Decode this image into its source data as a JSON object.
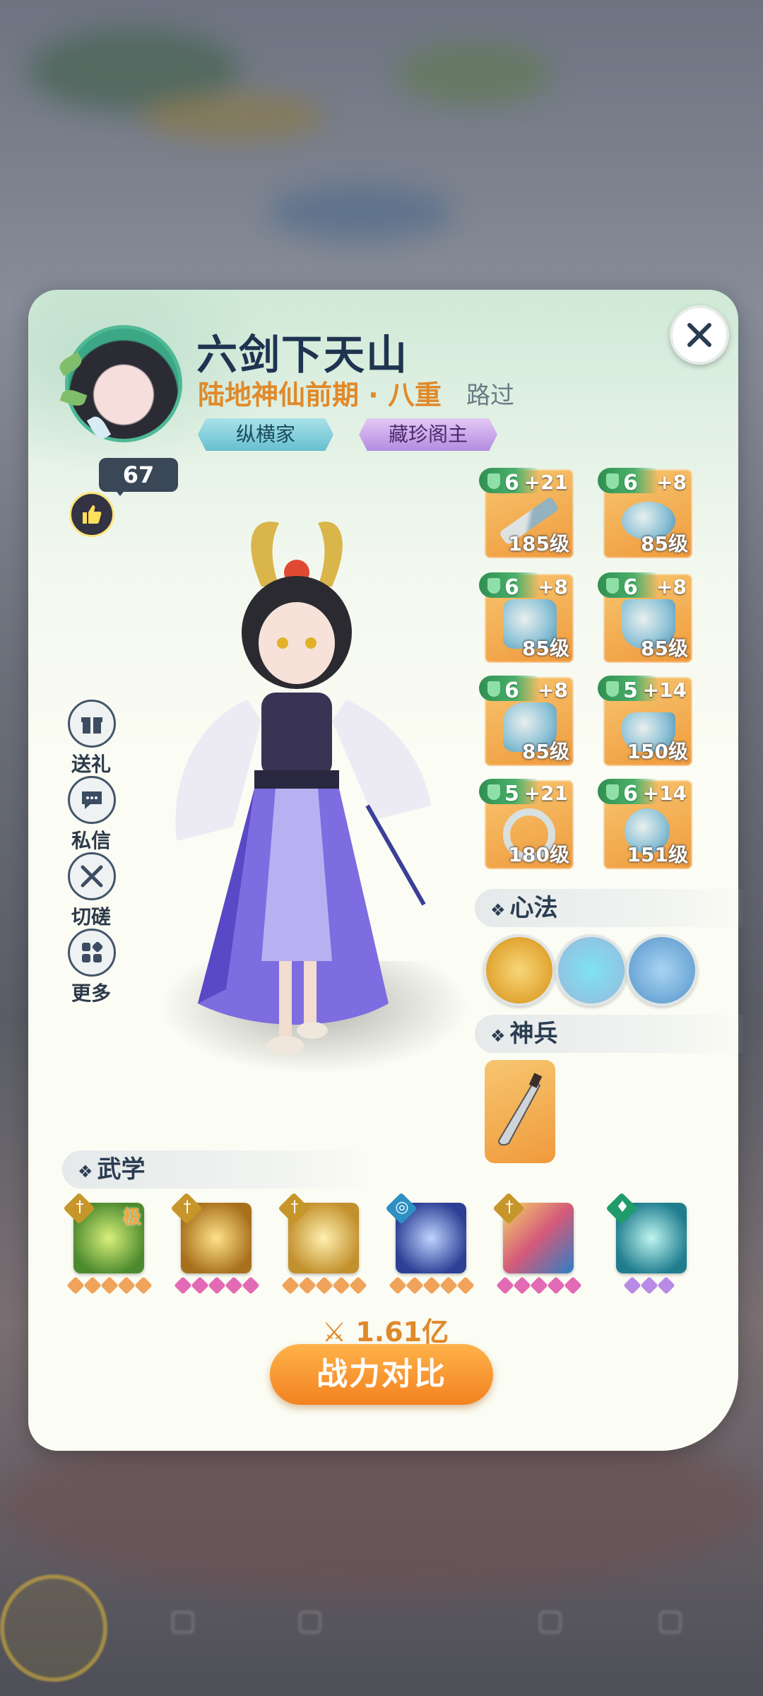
{
  "player": {
    "name": "六剑下天山",
    "realm": "陆地神仙前期 · 八重",
    "status": "路过",
    "tags": [
      "纵横家",
      "藏珍阁主"
    ],
    "likes": "67"
  },
  "side_actions": [
    {
      "label": "送礼",
      "icon": "gift-icon"
    },
    {
      "label": "私信",
      "icon": "message-icon"
    },
    {
      "label": "切磋",
      "icon": "crossed-swords-icon"
    },
    {
      "label": "更多",
      "icon": "more-grid-icon"
    }
  ],
  "equipment": [
    {
      "stars": "6",
      "plus": "+21",
      "level": "185级"
    },
    {
      "stars": "6",
      "plus": "+8",
      "level": "85级"
    },
    {
      "stars": "6",
      "plus": "+8",
      "level": "85级"
    },
    {
      "stars": "6",
      "plus": "+8",
      "level": "85级"
    },
    {
      "stars": "6",
      "plus": "+8",
      "level": "85级"
    },
    {
      "stars": "5",
      "plus": "+14",
      "level": "150级"
    },
    {
      "stars": "5",
      "plus": "+21",
      "level": "180级"
    },
    {
      "stars": "6",
      "plus": "+14",
      "level": "151级"
    }
  ],
  "sections": {
    "mental": "心法",
    "weapon": "神兵",
    "martial": "武学"
  },
  "skills": [
    {
      "rank": "极"
    },
    {
      "rank": ""
    },
    {
      "rank": ""
    },
    {
      "rank": ""
    },
    {
      "rank": ""
    },
    {
      "rank": ""
    }
  ],
  "power": {
    "value": "1.61亿",
    "compare_label": "战力对比"
  },
  "colors": {
    "accent_orange": "#f28220",
    "name_navy": "#1f3450",
    "realm_orange": "#e0892a"
  }
}
